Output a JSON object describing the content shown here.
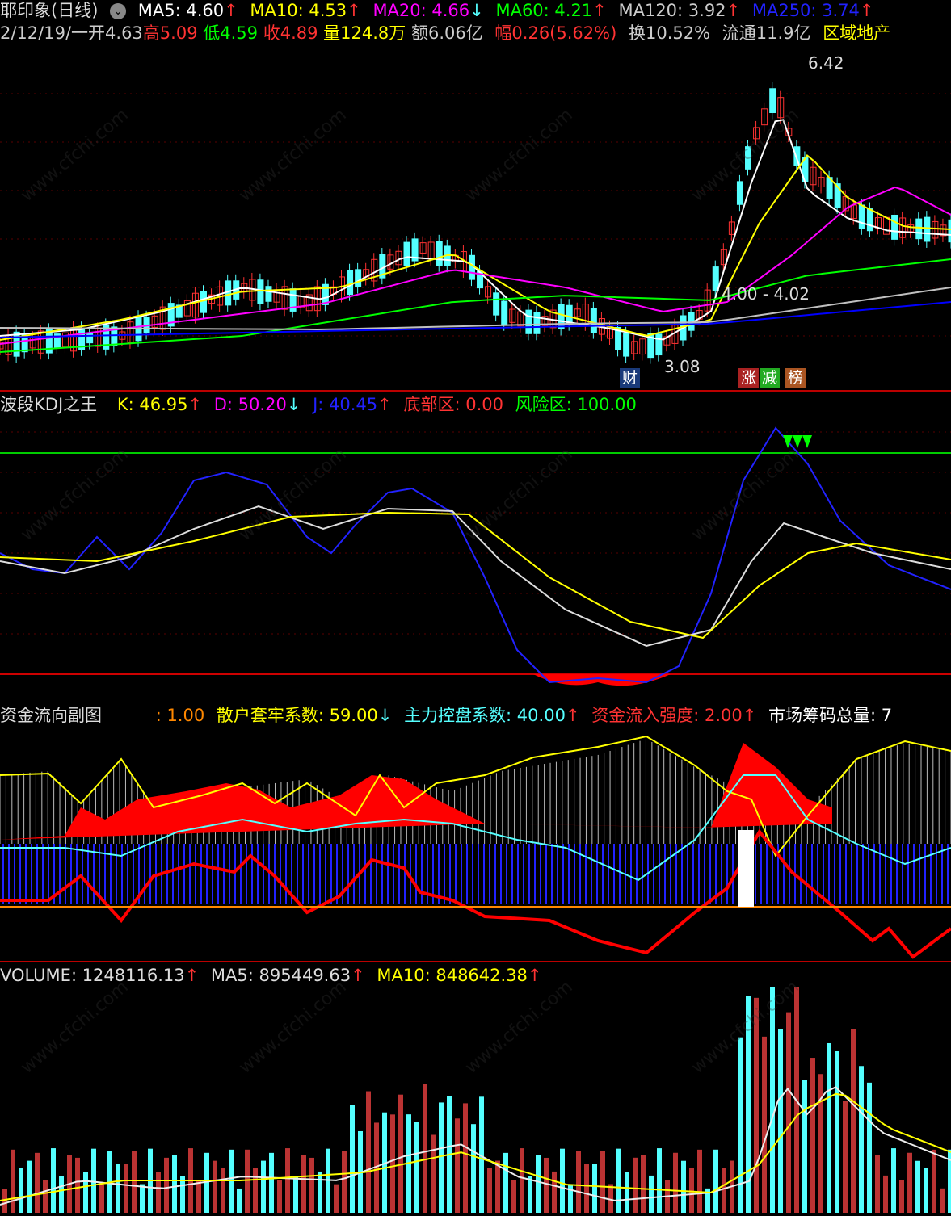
{
  "header": {
    "stock_name": "耶印象(日线)",
    "ma5": "MA5: 4.60",
    "ma10": "MA10: 4.53",
    "ma20": "MA20: 4.66",
    "ma60": "MA60: 4.21",
    "ma120": "MA120: 3.92",
    "ma250": "MA250: 3.74",
    "arrow_up": "↑",
    "arrow_down": "↓"
  },
  "quote": {
    "date": "2/12/19/一",
    "open": "开4.63",
    "high": "高5.09",
    "low": "低4.59",
    "close": "收4.89",
    "volume": "量124.8万",
    "amount": "额6.06亿",
    "change": "幅0.26(5.62%)",
    "turnover": "换10.52%",
    "float": "流通11.9亿",
    "sector": "区域地产"
  },
  "price_panel": {
    "high_mark": "6.42",
    "mid_mark": "4.00 - 4.02",
    "low_mark": "3.08",
    "badge_cai": "财",
    "badge_zhang": "涨",
    "badge_jian": "减",
    "badge_bang": "榜"
  },
  "kdj": {
    "title": "波段KDJ之王",
    "k": "K: 46.95",
    "d": "D: 50.20",
    "j": "J: 40.45",
    "bottom": "底部区: 0.00",
    "risk": "风险区: 100.00"
  },
  "flow": {
    "title": "资金流向副图",
    "p1": ": 1.00",
    "retail": "散户套牢系数: 59.00",
    "main": "主力控盘系数: 40.00",
    "inflow": "资金流入强度: 2.00",
    "chips": "市场筹码总量: 7"
  },
  "volume": {
    "vol": "VOLUME: 1248116.13",
    "ma5": "MA5: 895449.63",
    "ma10": "MA10: 848642.38"
  },
  "watermark": "www.cfchi.com",
  "colors": {
    "up": "#ff3232",
    "down": "#54ffff",
    "ma5": "#ffffff",
    "ma10": "#ffff00",
    "ma20": "#ff00ff",
    "ma60": "#00ff00",
    "ma120": "#c0c0c0",
    "ma250": "#0000ff"
  }
}
